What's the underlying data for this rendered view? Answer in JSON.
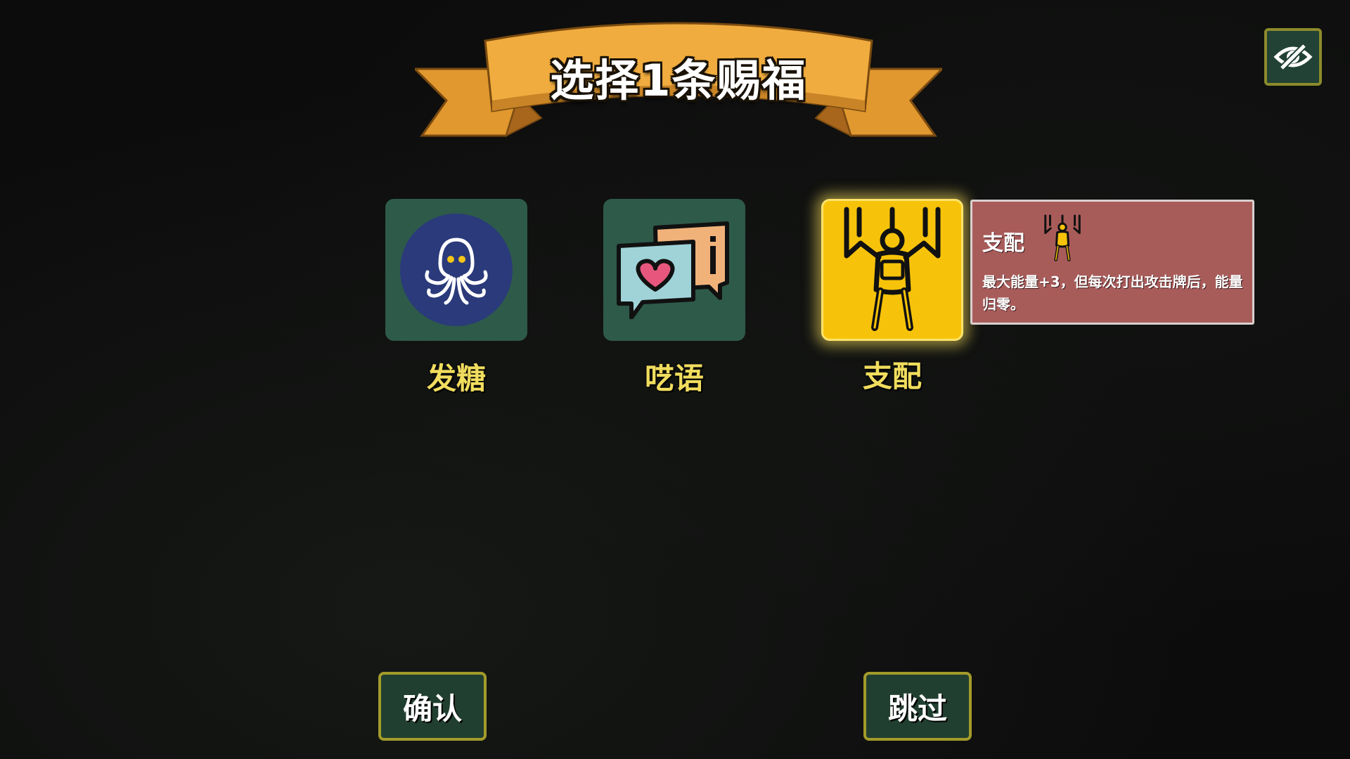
{
  "banner": {
    "title": "选择1条赐福"
  },
  "hide_toggle": {
    "icon": "eye-slash-icon"
  },
  "blessings": [
    {
      "label": "发糖",
      "icon": "octopus-icon",
      "selected": false
    },
    {
      "label": "呓语",
      "icon": "speech-bubbles-heart-icon",
      "selected": false
    },
    {
      "label": "支配",
      "icon": "puppet-marionette-icon",
      "selected": true
    }
  ],
  "tooltip": {
    "title": "支配",
    "icon": "puppet-marionette-icon",
    "description": "最大能量+3，但每次打出攻击牌后，能量归零。"
  },
  "buttons": {
    "confirm_label": "确认",
    "skip_label": "跳过"
  },
  "colors": {
    "card_teal": "#2e5a4a",
    "card_selected": "#f7c30a",
    "label_yellow": "#f1dd5e",
    "tooltip_bg": "#a85c5a",
    "ribbon_orange": "#e8a23a",
    "button_bg": "#213f30",
    "button_border": "#a39b2b"
  }
}
